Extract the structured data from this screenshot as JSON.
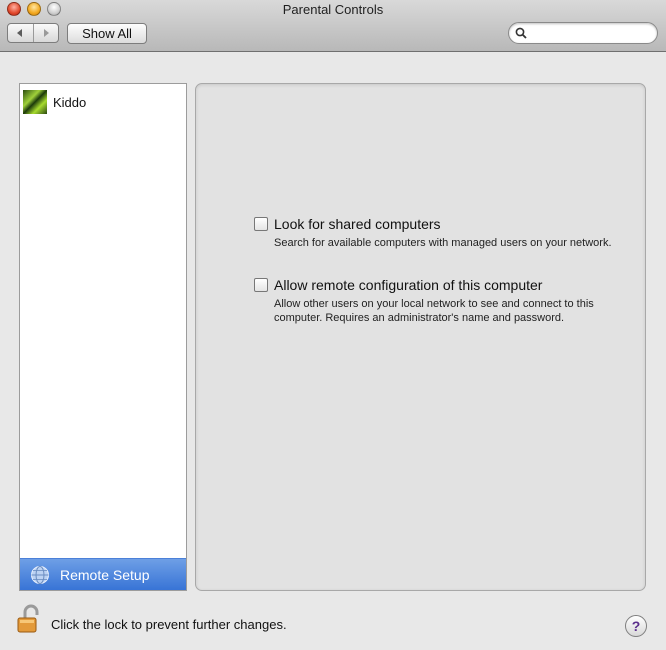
{
  "window": {
    "title": "Parental Controls"
  },
  "toolbar": {
    "show_all_label": "Show All",
    "search": {
      "placeholder": "",
      "value": ""
    }
  },
  "sidebar": {
    "users": [
      {
        "name": "Kiddo"
      }
    ],
    "remote_setup_label": "Remote Setup"
  },
  "options": [
    {
      "label": "Look for shared computers",
      "description": "Search for available computers with managed users on your network.",
      "checked": false
    },
    {
      "label": "Allow remote configuration of this computer",
      "description": "Allow other users on your local network to see and connect to this computer. Requires an administrator's name and password.",
      "checked": false
    }
  ],
  "footer": {
    "lock_text": "Click the lock to prevent further changes.",
    "help_label": "?"
  },
  "colors": {
    "selection": "#3874d6"
  }
}
